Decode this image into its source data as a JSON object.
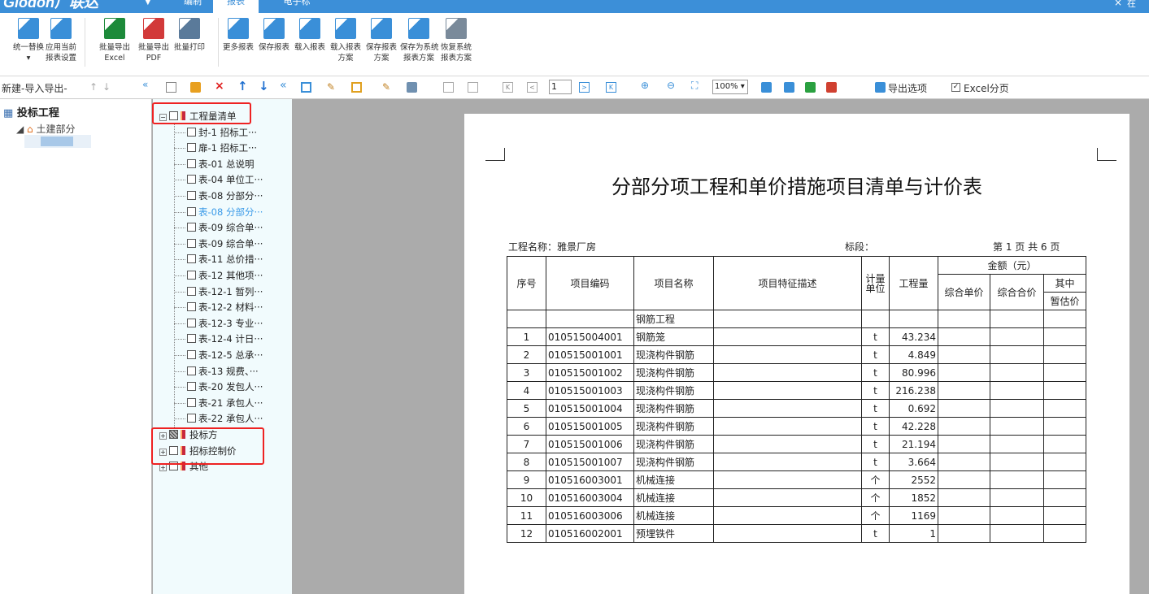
{
  "app": {
    "logo": "Glodon广联达",
    "logo_dd": "▼",
    "tabs": [
      "编制",
      "报表",
      "电子标"
    ],
    "close": "×",
    "user": "在"
  },
  "ribbon": [
    {
      "name": "unify-replace",
      "label1": "统一替换",
      "label2": "▾",
      "color": "#3a8fd8"
    },
    {
      "name": "apply-current",
      "label1": "应用当前",
      "label2": "报表设置",
      "color": "#3a8fd8"
    },
    {
      "name": "batch-excel",
      "label1": "批量导出",
      "label2": "Excel",
      "color": "#1d8a3a"
    },
    {
      "name": "batch-pdf",
      "label1": "批量导出",
      "label2": "PDF",
      "color": "#d23a3a"
    },
    {
      "name": "batch-print",
      "label1": "批量打印",
      "label2": "",
      "color": "#5a7a9a"
    },
    {
      "name": "more-reports",
      "label1": "更多报表",
      "label2": "",
      "color": "#3a8fd8"
    },
    {
      "name": "save-report",
      "label1": "保存报表",
      "label2": "",
      "color": "#3a8fd8"
    },
    {
      "name": "load-report",
      "label1": "载入报表",
      "label2": "",
      "color": "#3a8fd8"
    },
    {
      "name": "load-scheme",
      "label1": "载入报表",
      "label2": "方案",
      "color": "#3a8fd8"
    },
    {
      "name": "save-scheme",
      "label1": "保存报表",
      "label2": "方案",
      "color": "#3a8fd8"
    },
    {
      "name": "save-system",
      "label1": "保存为系统",
      "label2": "报表方案",
      "color": "#3a8fd8"
    },
    {
      "name": "restore-system",
      "label1": "恢复系统",
      "label2": "报表方案",
      "color": "#7a8a9a"
    }
  ],
  "toolbar": {
    "new_import": "新建-导入导出-",
    "page": "1",
    "zoom": "100% ▾",
    "export_options": "导出选项",
    "excel_page": "Excel分页"
  },
  "left": {
    "project": "投标工程",
    "sub": "土建部分"
  },
  "tree": [
    {
      "t": "工程量清单",
      "lvl": 0,
      "exp": "⊟"
    },
    {
      "t": "封-1 招标工···",
      "lvl": 1
    },
    {
      "t": "扉-1 招标工···",
      "lvl": 1
    },
    {
      "t": "表-01 总说明",
      "lvl": 1
    },
    {
      "t": "表-04 单位工···",
      "lvl": 1
    },
    {
      "t": "表-08 分部分···",
      "lvl": 1
    },
    {
      "t": "表-08 分部分···",
      "lvl": 1,
      "sel": true
    },
    {
      "t": "表-09 综合单···",
      "lvl": 1
    },
    {
      "t": "表-09 综合单···",
      "lvl": 1
    },
    {
      "t": "表-11 总价措···",
      "lvl": 1
    },
    {
      "t": "表-12 其他项···",
      "lvl": 1
    },
    {
      "t": "表-12-1 暂列···",
      "lvl": 1
    },
    {
      "t": "表-12-2 材料···",
      "lvl": 1
    },
    {
      "t": "表-12-3 专业···",
      "lvl": 1
    },
    {
      "t": "表-12-4 计日···",
      "lvl": 1
    },
    {
      "t": "表-12-5 总承···",
      "lvl": 1
    },
    {
      "t": "表-13 规费、···",
      "lvl": 1
    },
    {
      "t": "表-20 发包人···",
      "lvl": 1
    },
    {
      "t": "表-21 承包人···",
      "lvl": 1
    },
    {
      "t": "表-22 承包人···",
      "lvl": 1
    },
    {
      "t": "投标方",
      "lvl": 0,
      "exp": "⊞",
      "half": true
    },
    {
      "t": "招标控制价",
      "lvl": 0,
      "exp": "⊞"
    },
    {
      "t": "其他",
      "lvl": 0,
      "exp": "⊞"
    }
  ],
  "doc": {
    "title": "分部分项工程和单价措施项目清单与计价表",
    "proj": "工程名称：雅景厂房",
    "section": "标段：",
    "page": "第 1 页  共 6 页",
    "h": {
      "no": "序号",
      "code": "项目编码",
      "name": "项目名称",
      "desc": "项目特征描述",
      "unit": "计量单位",
      "qty": "工程量",
      "amount": "金额（元）",
      "uprice": "综合单价",
      "total": "综合合价",
      "of": "其中",
      "est": "暂估价"
    },
    "rows": [
      [
        "",
        "",
        "钢筋工程",
        "",
        "",
        ""
      ],
      [
        "1",
        "010515004001",
        "钢筋笼",
        "",
        "t",
        "43.234"
      ],
      [
        "2",
        "010515001001",
        "现浇构件钢筋",
        "",
        "t",
        "4.849"
      ],
      [
        "3",
        "010515001002",
        "现浇构件钢筋",
        "",
        "t",
        "80.996"
      ],
      [
        "4",
        "010515001003",
        "现浇构件钢筋",
        "",
        "t",
        "216.238"
      ],
      [
        "5",
        "010515001004",
        "现浇构件钢筋",
        "",
        "t",
        "0.692"
      ],
      [
        "6",
        "010515001005",
        "现浇构件钢筋",
        "",
        "t",
        "42.228"
      ],
      [
        "7",
        "010515001006",
        "现浇构件钢筋",
        "",
        "t",
        "21.194"
      ],
      [
        "8",
        "010515001007",
        "现浇构件钢筋",
        "",
        "t",
        "3.664"
      ],
      [
        "9",
        "010516003001",
        "机械连接",
        "",
        "个",
        "2552"
      ],
      [
        "10",
        "010516003004",
        "机械连接",
        "",
        "个",
        "1852"
      ],
      [
        "11",
        "010516003006",
        "机械连接",
        "",
        "个",
        "1169"
      ],
      [
        "12",
        "010516002001",
        "预埋铁件",
        "",
        "t",
        "1"
      ]
    ]
  }
}
